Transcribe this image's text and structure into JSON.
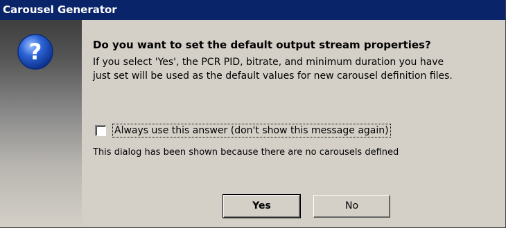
{
  "window": {
    "title": "Carousel Generator"
  },
  "dialog": {
    "icon": "question-icon",
    "heading": "Do you want to set the default output stream properties?",
    "body_line1": "If you select 'Yes', the PCR PID, bitrate, and minimum duration you have",
    "body_line2": "just set will be used as the default values for new carousel definition files.",
    "checkbox_label": "Always use this answer (don't show this message again)",
    "checkbox_checked": false,
    "reason_text": "This dialog has been shown because there are no carousels defined",
    "yes_label": "Yes",
    "no_label": "No"
  },
  "colors": {
    "titlebar": "#0a246a",
    "face": "#d4d0c8",
    "icon_blue": "#1f4fbf"
  }
}
